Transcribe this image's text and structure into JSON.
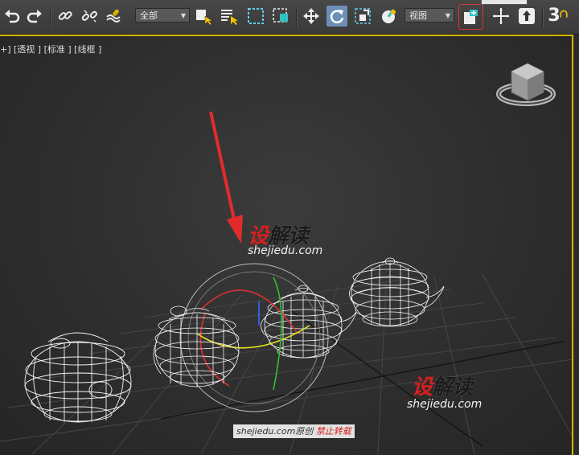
{
  "toolbar": {
    "selection_filter": "全部",
    "coordinate_system": "视图",
    "snap_number": "3"
  },
  "viewport": {
    "label": "+] [透视 ] [标准 ] [线框 ]"
  },
  "watermark": {
    "brand_red": "设",
    "brand_dark": "解读",
    "url": "shejiedu.com"
  },
  "copyright": {
    "site": "shejiedu.com原创",
    "notice": "禁止转载"
  },
  "colors": {
    "accent": "#d8b400",
    "active_button": "#6d8fb7",
    "arrow": "#e32b2b"
  }
}
